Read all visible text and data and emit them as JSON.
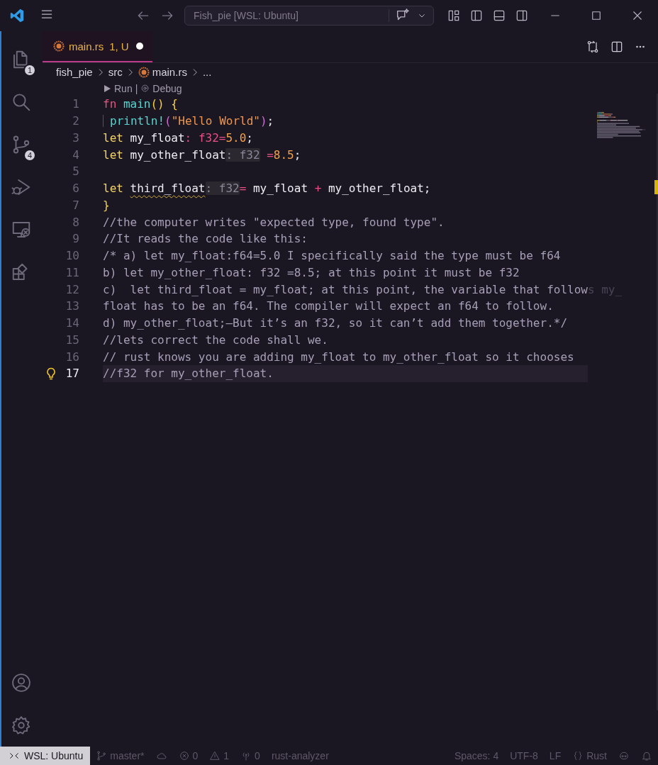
{
  "titlebar": {
    "title": "Fish_pie [WSL: Ubuntu]"
  },
  "activity_bar": {
    "top": [
      {
        "kind": "files",
        "badge": "1"
      },
      {
        "kind": "search"
      },
      {
        "kind": "scm",
        "badge": "4"
      },
      {
        "kind": "debug"
      },
      {
        "kind": "remote"
      },
      {
        "kind": "extensions"
      }
    ],
    "bottom": [
      {
        "kind": "account"
      },
      {
        "kind": "settings"
      }
    ]
  },
  "tab": {
    "label": "main.rs",
    "status": "1, U",
    "modified": true,
    "selected": true
  },
  "breadcrumbs": [
    "fish_pie",
    "src",
    "main.rs",
    "..."
  ],
  "codelens": [
    "Run",
    "|",
    "Debug"
  ],
  "lines": [
    {
      "number": "1",
      "current": false,
      "guide": false,
      "lightbulb": false,
      "tokens": [
        {
          "kind": "fnkw",
          "text": "fn"
        },
        {
          "kind": "func",
          "text": " main"
        },
        {
          "kind": "brace",
          "text": "()"
        },
        {
          "kind": "brace",
          "text": " {"
        }
      ]
    },
    {
      "number": "2",
      "current": false,
      "guide": true,
      "lightbulb": false,
      "tokens": [
        {
          "kind": "func",
          "text": "println!"
        },
        {
          "kind": "paren",
          "text": "("
        },
        {
          "kind": "string",
          "text": "\"Hello World\""
        },
        {
          "kind": "paren",
          "text": ")"
        },
        {
          "kind": "var",
          "text": ";"
        }
      ]
    },
    {
      "number": "3",
      "current": false,
      "guide": false,
      "lightbulb": false,
      "tokens": [
        {
          "kind": "letkw",
          "text": "let"
        },
        {
          "kind": "var",
          "text": " my_float"
        },
        {
          "kind": "op",
          "text": ":"
        },
        {
          "kind": "type",
          "text": " f32"
        },
        {
          "kind": "op",
          "text": "="
        },
        {
          "kind": "num",
          "text": "5.0"
        },
        {
          "kind": "var",
          "text": ";"
        }
      ]
    },
    {
      "number": "4",
      "current": false,
      "guide": false,
      "lightbulb": false,
      "tokens": [
        {
          "kind": "letkw",
          "text": "let"
        },
        {
          "kind": "var",
          "text": " my_other_float"
        },
        {
          "kind": "hint",
          "text": ": f32"
        },
        {
          "kind": "op",
          "text": " ="
        },
        {
          "kind": "num",
          "text": "8.5"
        },
        {
          "kind": "var",
          "text": ";"
        }
      ]
    },
    {
      "number": "5",
      "current": false,
      "guide": false,
      "lightbulb": false
    },
    {
      "number": "6",
      "current": false,
      "guide": false,
      "lightbulb": false,
      "tokens": [
        {
          "kind": "letkw",
          "text": "let "
        },
        {
          "kind": "warn",
          "text": "third_float"
        },
        {
          "kind": "hint",
          "text": ": f32"
        },
        {
          "kind": "op",
          "text": "="
        },
        {
          "kind": "var",
          "text": " my_float "
        },
        {
          "kind": "op",
          "text": "+"
        },
        {
          "kind": "var",
          "text": " my_other_float;"
        }
      ]
    },
    {
      "number": "7",
      "current": false,
      "guide": false,
      "lightbulb": false,
      "tokens": [
        {
          "kind": "brace",
          "text": "}"
        }
      ]
    },
    {
      "number": "8",
      "current": false,
      "guide": false,
      "lightbulb": false,
      "tokens": [
        {
          "kind": "comment",
          "text": "//the computer writes \"expected type, found type\"."
        }
      ]
    },
    {
      "number": "9",
      "current": false,
      "guide": false,
      "lightbulb": false,
      "tokens": [
        {
          "kind": "comment",
          "text": "//It reads the code like this:"
        }
      ]
    },
    {
      "number": "10",
      "current": false,
      "guide": false,
      "lightbulb": false,
      "tokens": [
        {
          "kind": "comment",
          "text": "/* a) let my_float:f64=5.0 I specifically said the type must be f64"
        }
      ]
    },
    {
      "number": "11",
      "current": false,
      "guide": false,
      "lightbulb": false,
      "tokens": [
        {
          "kind": "comment",
          "text": "b) let my_other_float: f32 =8.5; at this point it must be f32"
        }
      ]
    },
    {
      "number": "12",
      "current": false,
      "guide": false,
      "lightbulb": false,
      "tokens": [
        {
          "kind": "comment",
          "text": "c)  let third_float = my_float; at this point, the variable that follow"
        },
        {
          "kind": "ghost",
          "text": "s my_"
        }
      ]
    },
    {
      "number": "13",
      "current": false,
      "guide": false,
      "lightbulb": false,
      "tokens": [
        {
          "kind": "comment",
          "text": "float has to be an f64. The compiler will expect an f64 to follow."
        }
      ]
    },
    {
      "number": "14",
      "current": false,
      "guide": false,
      "lightbulb": false,
      "tokens": [
        {
          "kind": "comment",
          "text": "d) my_other_float;—But it’s an f32, so it can’t add them together.*/"
        }
      ]
    },
    {
      "number": "15",
      "current": false,
      "guide": false,
      "lightbulb": false,
      "tokens": [
        {
          "kind": "comment",
          "text": "//lets correct the code shall we."
        }
      ]
    },
    {
      "number": "16",
      "current": false,
      "guide": false,
      "lightbulb": false,
      "tokens": [
        {
          "kind": "comment",
          "text": "// rust knows you are adding my_float to my_other_float so it chooses"
        }
      ]
    },
    {
      "number": "17",
      "current": true,
      "guide": false,
      "lightbulb": true,
      "tokens": [
        {
          "kind": "comment",
          "text": "//f32 for my_other_float."
        }
      ]
    }
  ],
  "status_bar": [
    {
      "kind": "remote",
      "text": "WSL: Ubuntu"
    },
    {
      "kind": "branch",
      "text": "master*"
    },
    {
      "kind": "sync"
    },
    {
      "kind": "errors",
      "text": "0"
    },
    {
      "kind": "warnings",
      "text": "1"
    },
    {
      "kind": "ports",
      "text": "0"
    },
    {
      "kind": "plain",
      "text": "rust-analyzer"
    },
    {
      "kind": "spacer"
    },
    {
      "kind": "plain",
      "text": "Spaces: 4"
    },
    {
      "kind": "plain",
      "text": "UTF-8"
    },
    {
      "kind": "plain",
      "text": "LF"
    },
    {
      "kind": "language",
      "text": "Rust"
    },
    {
      "kind": "copilot"
    },
    {
      "kind": "bell"
    }
  ]
}
